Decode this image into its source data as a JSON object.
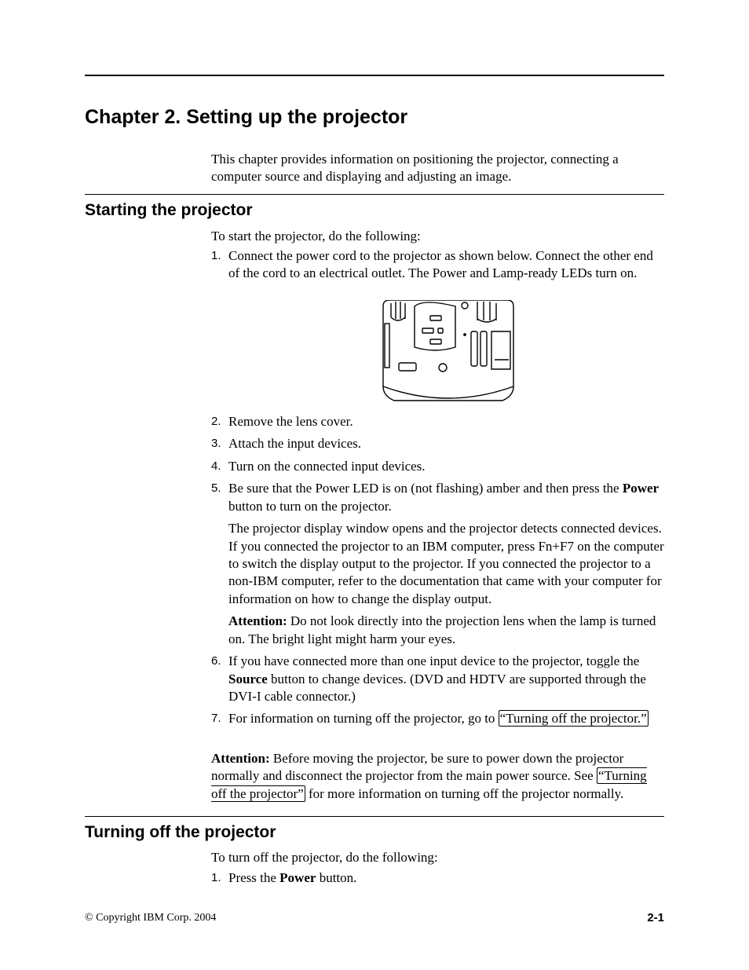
{
  "chapter_title": "Chapter 2. Setting up the projector",
  "intro": "This chapter provides information on positioning the projector, connecting a computer source and displaying and adjusting an image.",
  "section1": {
    "title": "Starting the projector",
    "intro": "To start the projector, do the following:",
    "items": [
      {
        "num": "1.",
        "text": "Connect the power cord to the projector as shown below. Connect the other end of the cord to an electrical outlet. The Power and Lamp-ready LEDs turn on."
      },
      {
        "num": "2.",
        "text": "Remove the lens cover."
      },
      {
        "num": "3.",
        "text": "Attach the input devices."
      },
      {
        "num": "4.",
        "text": "Turn on the connected input devices."
      },
      {
        "num": "5.",
        "pre": "Be sure that the Power LED is on (not flashing) amber and then press the ",
        "bold": "Power",
        "post": " button to turn on the projector.",
        "para2": "The projector display window opens and the projector detects connected devices. If you connected the projector to an IBM computer, press Fn+F7 on the computer to switch the display output to the projector. If you connected the projector to a non-IBM computer, refer to the documentation that came with your computer for information on how to change the display output.",
        "attn_label": "Attention:",
        "attn_text": "   Do not look directly into the projection lens when the lamp is turned on. The bright light might harm your eyes."
      },
      {
        "num": "6.",
        "pre": "If you have connected more than one input device to the projector, toggle the ",
        "bold": "Source",
        "post": " button to change devices. (DVD and HDTV are supported through the DVI-I cable connector.)"
      },
      {
        "num": "7.",
        "pre": "For information on turning off the projector, go to ",
        "xref": "“Turning off the projector.”"
      }
    ],
    "attention": {
      "label": "Attention:",
      "pre": "   Before moving the projector, be sure to power down the projector normally and disconnect the projector from the main power source. See ",
      "xref": "“Turning off the projector”",
      "post": " for more information on turning off the projector normally."
    }
  },
  "section2": {
    "title": "Turning off the projector",
    "intro": "To turn off the projector, do the following:",
    "item1": {
      "num": "1.",
      "pre": "Press the ",
      "bold": "Power",
      "post": " button."
    }
  },
  "footer": {
    "copyright": "© Copyright IBM Corp. 2004",
    "page": "2-1"
  }
}
